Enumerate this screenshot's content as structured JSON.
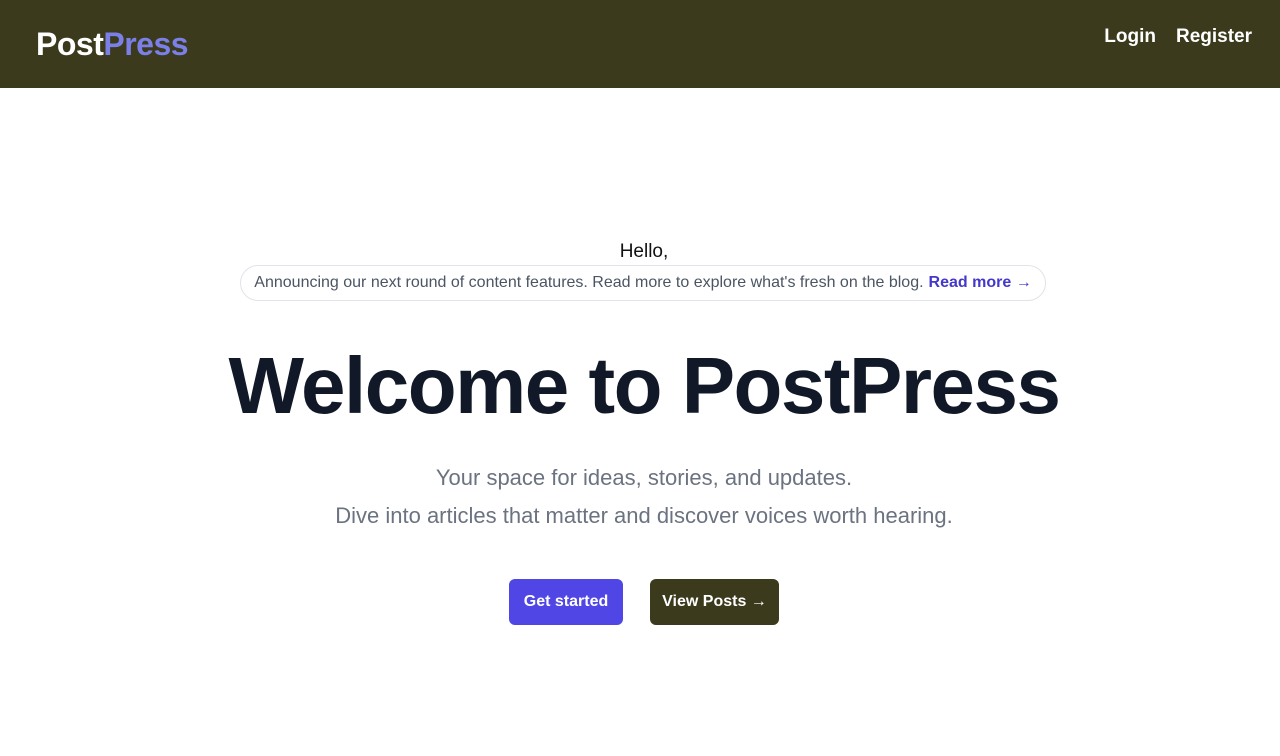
{
  "header": {
    "logo_part1": "Post",
    "logo_part2": "Press",
    "nav": {
      "login": "Login",
      "register": "Register"
    }
  },
  "main": {
    "greeting": "Hello,",
    "announcement": {
      "text": "Announcing our next round of content features. Read more to explore what's fresh on the blog.",
      "link": "Read more →"
    },
    "title": "Welcome to PostPress",
    "subtitle_line1": "Your space for ideas, stories, and updates.",
    "subtitle_line2": "Dive into articles that matter and discover voices worth hearing.",
    "buttons": {
      "get_started": "Get started",
      "view_posts": "View Posts →"
    }
  },
  "colors": {
    "header_bg": "#3b3a1c",
    "accent": "#4f46e5",
    "logo_accent": "#7b7fe8"
  }
}
